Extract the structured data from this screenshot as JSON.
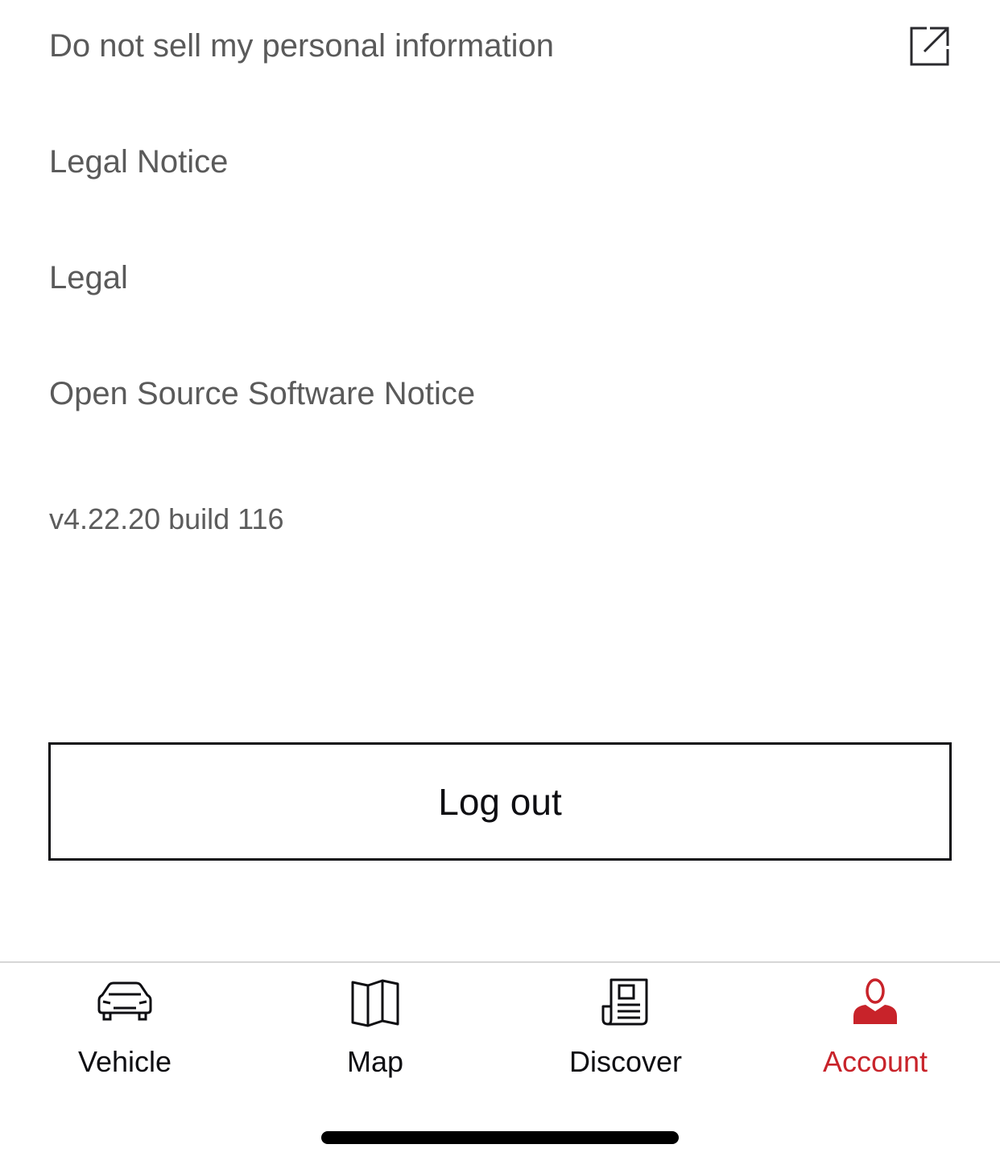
{
  "menu": {
    "items": [
      {
        "label": "Do not sell my personal information",
        "external": true,
        "icon": "external-link-icon"
      },
      {
        "label": "Legal Notice"
      },
      {
        "label": "Legal"
      },
      {
        "label": "Open Source Software Notice"
      }
    ]
  },
  "version_text": "v4.22.20 build 116",
  "logout_label": "Log out",
  "tabbar": {
    "tabs": [
      {
        "label": "Vehicle",
        "icon": "car-icon",
        "active": false
      },
      {
        "label": "Map",
        "icon": "map-icon",
        "active": false
      },
      {
        "label": "Discover",
        "icon": "newspaper-icon",
        "active": false
      },
      {
        "label": "Account",
        "icon": "person-icon",
        "active": true
      }
    ]
  },
  "colors": {
    "accent": "#c8232a",
    "text_primary": "#0e0e12",
    "text_secondary": "#5a5a5a",
    "divider": "#d6d6d6"
  }
}
